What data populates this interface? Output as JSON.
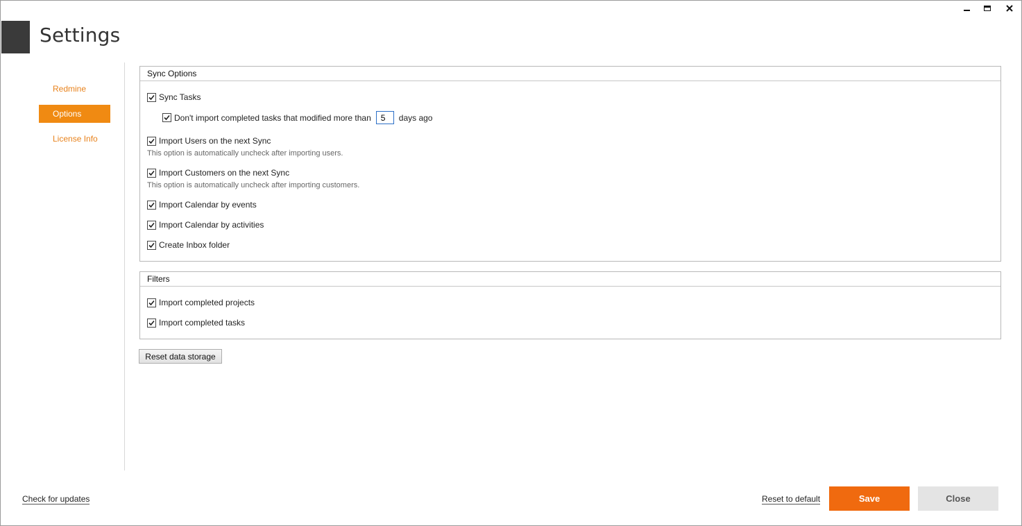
{
  "header": {
    "title": "Settings"
  },
  "window_controls": {
    "minimize_icon": "minimize-icon",
    "maximize_icon": "maximize-icon",
    "close_icon": "close-icon"
  },
  "sidebar": {
    "items": [
      {
        "label": "Redmine",
        "active": false
      },
      {
        "label": "Options",
        "active": true
      },
      {
        "label": "License Info",
        "active": false
      }
    ]
  },
  "sync_options": {
    "title": "Sync Options",
    "sync_tasks": {
      "label": "Sync Tasks",
      "checked": true
    },
    "dont_import_completed": {
      "label": "Don't import completed tasks that modified more than",
      "checked": true,
      "days_value": "5",
      "suffix": "days ago"
    },
    "import_users": {
      "label": "Import Users on the next Sync",
      "checked": true,
      "hint": "This option is automatically uncheck after importing users."
    },
    "import_customers": {
      "label": "Import Customers on the next Sync",
      "checked": true,
      "hint": "This option is automatically uncheck after importing customers."
    },
    "import_calendar_events": {
      "label": "Import Calendar by events",
      "checked": true
    },
    "import_calendar_activities": {
      "label": "Import Calendar by activities",
      "checked": true
    },
    "create_inbox": {
      "label": "Create Inbox folder",
      "checked": true
    }
  },
  "filters": {
    "title": "Filters",
    "import_completed_projects": {
      "label": "Import completed projects",
      "checked": true
    },
    "import_completed_tasks": {
      "label": "Import completed tasks",
      "checked": true
    }
  },
  "actions": {
    "reset_storage_label": "Reset data storage",
    "check_updates_label": "Check for updates",
    "reset_default_label": "Reset to default",
    "save_label": "Save",
    "close_label": "Close"
  },
  "colors": {
    "accent": "#f08a12",
    "save_button": "#f06a0f",
    "close_button": "#e4e4e4"
  }
}
